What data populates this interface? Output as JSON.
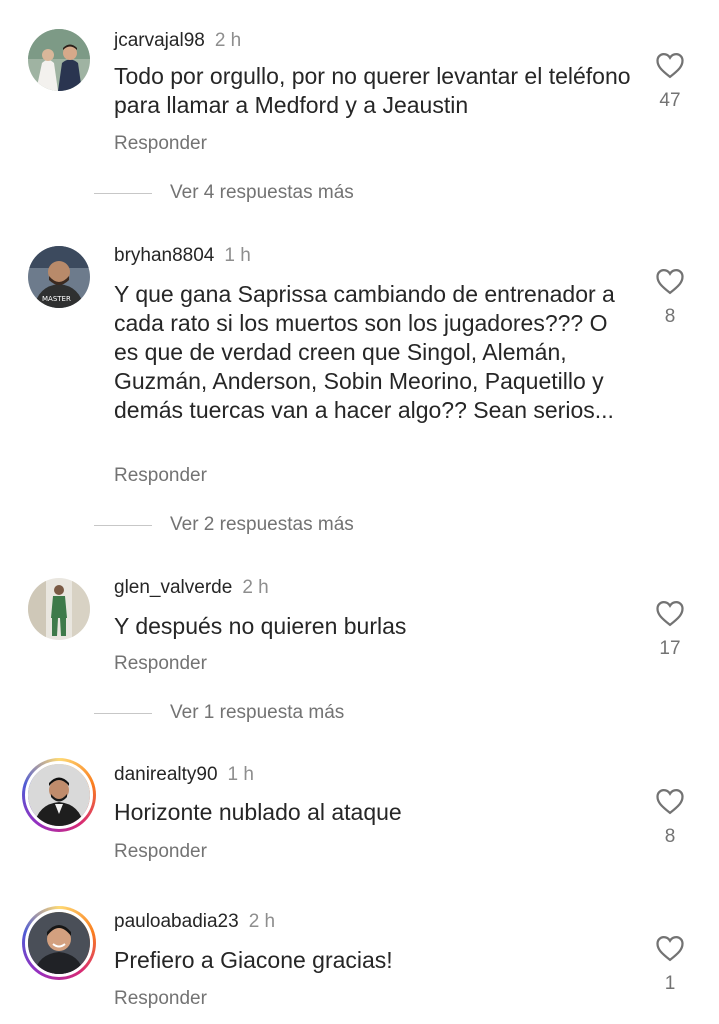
{
  "comments": [
    {
      "username": "jcarvajal98",
      "time": "2 h",
      "text": "Todo por orgullo, por no querer levantar el teléfono para llamar a Medford y a Jeaustin",
      "reply_label": "Responder",
      "likes": "47",
      "avatar": "avatar-wedding-photo",
      "more_replies": "Ver 4 respuestas más"
    },
    {
      "username": "bryhan8804",
      "time": "1 h",
      "text": "Y que gana Saprissa cambiando de entrenador a cada rato si los muertos son los jugadores??? O es que de verdad creen que Singol, Alemán, Guzmán, Anderson, Sobin Meorino, Paquetillo y demás tuercas van a hacer algo?? Sean serios...",
      "reply_label": "Responder",
      "likes": "8",
      "avatar": "avatar-man-photo",
      "more_replies": "Ver 2 respuestas más"
    },
    {
      "username": "glen_valverde",
      "time": "2 h",
      "text": "Y después no quieren burlas",
      "reply_label": "Responder",
      "likes": "17",
      "avatar": "avatar-standing-person",
      "more_replies": "Ver 1 respuesta más"
    },
    {
      "username": "danirealty90",
      "time": "1 h",
      "text": "Horizonte nublado al ataque",
      "reply_label": "Responder",
      "likes": "8",
      "avatar": "avatar-man-suit-story-ring"
    },
    {
      "username": "pauloabadia23",
      "time": "2 h",
      "text": "Prefiero a Giacone gracias!",
      "reply_label": "Responder",
      "likes": "1",
      "avatar": "avatar-smiling-man-story-ring"
    }
  ],
  "colors": {
    "text": "#262626",
    "secondary": "#737373",
    "time": "#8e8e8e",
    "divider": "#c7c7c7"
  },
  "icons": {
    "like": "heart-outline-icon"
  }
}
